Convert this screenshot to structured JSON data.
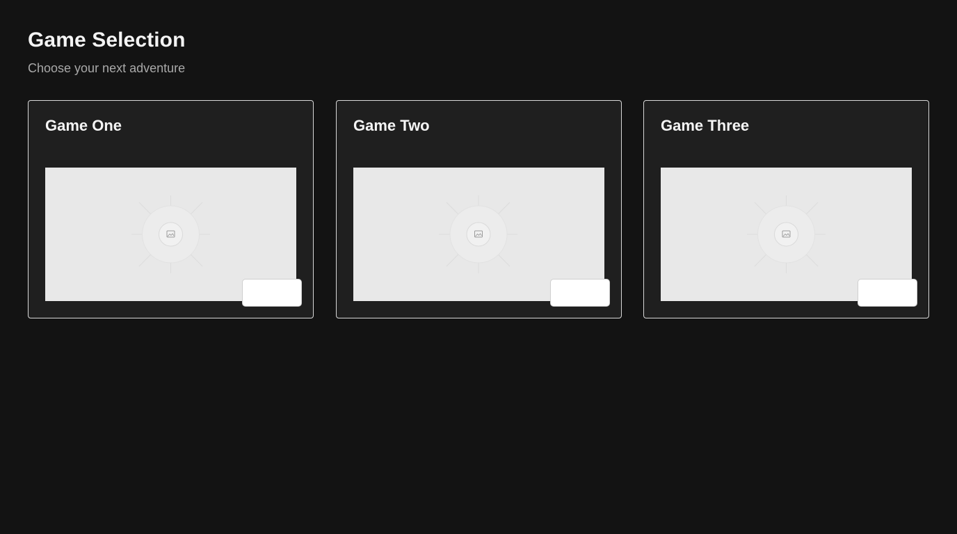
{
  "header": {
    "title": "Game Selection",
    "subtitle": "Choose your next adventure"
  },
  "games": [
    {
      "title": "Game One",
      "image_icon": "image-placeholder-icon",
      "button_label": ""
    },
    {
      "title": "Game Two",
      "image_icon": "image-placeholder-icon",
      "button_label": ""
    },
    {
      "title": "Game Three",
      "image_icon": "image-placeholder-icon",
      "button_label": ""
    }
  ],
  "colors": {
    "background": "#131313",
    "card_background": "#1f1f1f",
    "card_border": "#d9d9d9",
    "image_placeholder": "#e8e8e8",
    "button": "#ffffff"
  }
}
